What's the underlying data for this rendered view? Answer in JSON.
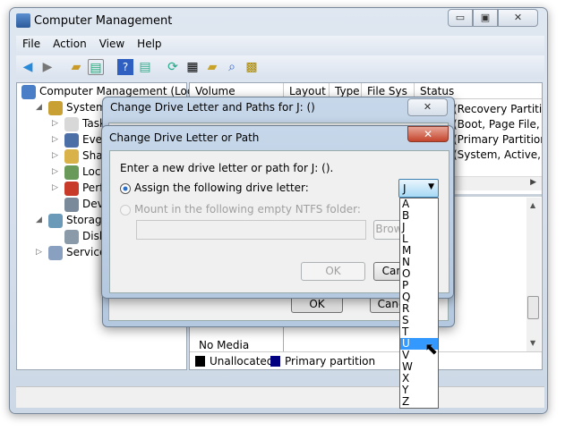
{
  "window": {
    "title": "Computer Management",
    "min": "▭",
    "max": "▣",
    "close": "✕"
  },
  "menu": [
    "File",
    "Action",
    "View",
    "Help"
  ],
  "tree": [
    {
      "label": "Computer Management (Local",
      "level": 0
    },
    {
      "label": "System Tools",
      "level": 1
    },
    {
      "label": "Task Scheduler",
      "level": 2
    },
    {
      "label": "Event Viewer",
      "level": 2
    },
    {
      "label": "Shared Folders",
      "level": 2
    },
    {
      "label": "Local Users and Groups",
      "level": 2
    },
    {
      "label": "Performance",
      "level": 2
    },
    {
      "label": "Device Manager",
      "level": 2
    },
    {
      "label": "Storage",
      "level": 1
    },
    {
      "label": "Disk Management",
      "level": 2
    },
    {
      "label": "Services and Applications",
      "level": 1
    }
  ],
  "columns": [
    "Volume",
    "Layout",
    "Type",
    "File Sys",
    "Status"
  ],
  "status_rows": [
    "(Recovery Partition",
    "(Boot, Page File, C",
    "(Primary Partition",
    "(System, Active, P"
  ],
  "lower": {
    "no_media": "No Media"
  },
  "legend": [
    {
      "label": "Unallocated",
      "color": "#000000"
    },
    {
      "label": "Primary partition",
      "color": "#000080"
    }
  ],
  "outer_dialog": {
    "title": "Change Drive Letter and Paths for J: ()",
    "ok": "OK",
    "cancel": "Cancel"
  },
  "inner_dialog": {
    "title": "Change Drive Letter or Path",
    "prompt": "Enter a new drive letter or path for J: ().",
    "assign_label": "Assign the following drive letter:",
    "mount_label": "Mount in the following empty NTFS folder:",
    "folder_value": "",
    "browse": "Browse...",
    "ok": "OK",
    "cancel": "Cancel",
    "selected_letter": "J"
  },
  "letters": [
    "A",
    "B",
    "J",
    "L",
    "M",
    "N",
    "O",
    "P",
    "Q",
    "R",
    "S",
    "T",
    "U",
    "V",
    "W",
    "X",
    "Y",
    "Z"
  ],
  "highlighted_letter": "U"
}
